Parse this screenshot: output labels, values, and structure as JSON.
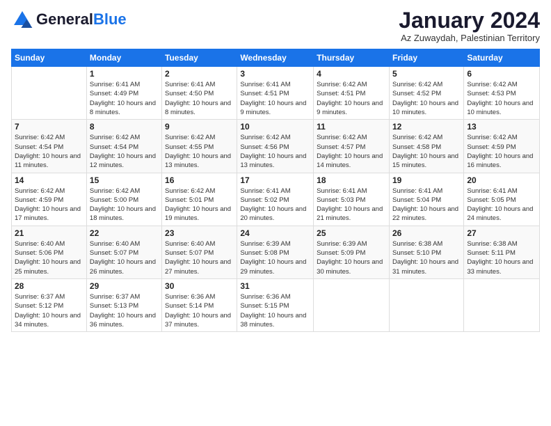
{
  "logo": {
    "general": "General",
    "blue": "Blue"
  },
  "header": {
    "month_year": "January 2024",
    "location": "Az Zuwaydah, Palestinian Territory"
  },
  "days_of_week": [
    "Sunday",
    "Monday",
    "Tuesday",
    "Wednesday",
    "Thursday",
    "Friday",
    "Saturday"
  ],
  "weeks": [
    [
      {
        "day": "",
        "sunrise": "",
        "sunset": "",
        "daylight": "",
        "empty": true
      },
      {
        "day": "1",
        "sunrise": "Sunrise: 6:41 AM",
        "sunset": "Sunset: 4:49 PM",
        "daylight": "Daylight: 10 hours and 8 minutes."
      },
      {
        "day": "2",
        "sunrise": "Sunrise: 6:41 AM",
        "sunset": "Sunset: 4:50 PM",
        "daylight": "Daylight: 10 hours and 8 minutes."
      },
      {
        "day": "3",
        "sunrise": "Sunrise: 6:41 AM",
        "sunset": "Sunset: 4:51 PM",
        "daylight": "Daylight: 10 hours and 9 minutes."
      },
      {
        "day": "4",
        "sunrise": "Sunrise: 6:42 AM",
        "sunset": "Sunset: 4:51 PM",
        "daylight": "Daylight: 10 hours and 9 minutes."
      },
      {
        "day": "5",
        "sunrise": "Sunrise: 6:42 AM",
        "sunset": "Sunset: 4:52 PM",
        "daylight": "Daylight: 10 hours and 10 minutes."
      },
      {
        "day": "6",
        "sunrise": "Sunrise: 6:42 AM",
        "sunset": "Sunset: 4:53 PM",
        "daylight": "Daylight: 10 hours and 10 minutes."
      }
    ],
    [
      {
        "day": "7",
        "sunrise": "Sunrise: 6:42 AM",
        "sunset": "Sunset: 4:54 PM",
        "daylight": "Daylight: 10 hours and 11 minutes."
      },
      {
        "day": "8",
        "sunrise": "Sunrise: 6:42 AM",
        "sunset": "Sunset: 4:54 PM",
        "daylight": "Daylight: 10 hours and 12 minutes."
      },
      {
        "day": "9",
        "sunrise": "Sunrise: 6:42 AM",
        "sunset": "Sunset: 4:55 PM",
        "daylight": "Daylight: 10 hours and 13 minutes."
      },
      {
        "day": "10",
        "sunrise": "Sunrise: 6:42 AM",
        "sunset": "Sunset: 4:56 PM",
        "daylight": "Daylight: 10 hours and 13 minutes."
      },
      {
        "day": "11",
        "sunrise": "Sunrise: 6:42 AM",
        "sunset": "Sunset: 4:57 PM",
        "daylight": "Daylight: 10 hours and 14 minutes."
      },
      {
        "day": "12",
        "sunrise": "Sunrise: 6:42 AM",
        "sunset": "Sunset: 4:58 PM",
        "daylight": "Daylight: 10 hours and 15 minutes."
      },
      {
        "day": "13",
        "sunrise": "Sunrise: 6:42 AM",
        "sunset": "Sunset: 4:59 PM",
        "daylight": "Daylight: 10 hours and 16 minutes."
      }
    ],
    [
      {
        "day": "14",
        "sunrise": "Sunrise: 6:42 AM",
        "sunset": "Sunset: 4:59 PM",
        "daylight": "Daylight: 10 hours and 17 minutes."
      },
      {
        "day": "15",
        "sunrise": "Sunrise: 6:42 AM",
        "sunset": "Sunset: 5:00 PM",
        "daylight": "Daylight: 10 hours and 18 minutes."
      },
      {
        "day": "16",
        "sunrise": "Sunrise: 6:42 AM",
        "sunset": "Sunset: 5:01 PM",
        "daylight": "Daylight: 10 hours and 19 minutes."
      },
      {
        "day": "17",
        "sunrise": "Sunrise: 6:41 AM",
        "sunset": "Sunset: 5:02 PM",
        "daylight": "Daylight: 10 hours and 20 minutes."
      },
      {
        "day": "18",
        "sunrise": "Sunrise: 6:41 AM",
        "sunset": "Sunset: 5:03 PM",
        "daylight": "Daylight: 10 hours and 21 minutes."
      },
      {
        "day": "19",
        "sunrise": "Sunrise: 6:41 AM",
        "sunset": "Sunset: 5:04 PM",
        "daylight": "Daylight: 10 hours and 22 minutes."
      },
      {
        "day": "20",
        "sunrise": "Sunrise: 6:41 AM",
        "sunset": "Sunset: 5:05 PM",
        "daylight": "Daylight: 10 hours and 24 minutes."
      }
    ],
    [
      {
        "day": "21",
        "sunrise": "Sunrise: 6:40 AM",
        "sunset": "Sunset: 5:06 PM",
        "daylight": "Daylight: 10 hours and 25 minutes."
      },
      {
        "day": "22",
        "sunrise": "Sunrise: 6:40 AM",
        "sunset": "Sunset: 5:07 PM",
        "daylight": "Daylight: 10 hours and 26 minutes."
      },
      {
        "day": "23",
        "sunrise": "Sunrise: 6:40 AM",
        "sunset": "Sunset: 5:07 PM",
        "daylight": "Daylight: 10 hours and 27 minutes."
      },
      {
        "day": "24",
        "sunrise": "Sunrise: 6:39 AM",
        "sunset": "Sunset: 5:08 PM",
        "daylight": "Daylight: 10 hours and 29 minutes."
      },
      {
        "day": "25",
        "sunrise": "Sunrise: 6:39 AM",
        "sunset": "Sunset: 5:09 PM",
        "daylight": "Daylight: 10 hours and 30 minutes."
      },
      {
        "day": "26",
        "sunrise": "Sunrise: 6:38 AM",
        "sunset": "Sunset: 5:10 PM",
        "daylight": "Daylight: 10 hours and 31 minutes."
      },
      {
        "day": "27",
        "sunrise": "Sunrise: 6:38 AM",
        "sunset": "Sunset: 5:11 PM",
        "daylight": "Daylight: 10 hours and 33 minutes."
      }
    ],
    [
      {
        "day": "28",
        "sunrise": "Sunrise: 6:37 AM",
        "sunset": "Sunset: 5:12 PM",
        "daylight": "Daylight: 10 hours and 34 minutes."
      },
      {
        "day": "29",
        "sunrise": "Sunrise: 6:37 AM",
        "sunset": "Sunset: 5:13 PM",
        "daylight": "Daylight: 10 hours and 36 minutes."
      },
      {
        "day": "30",
        "sunrise": "Sunrise: 6:36 AM",
        "sunset": "Sunset: 5:14 PM",
        "daylight": "Daylight: 10 hours and 37 minutes."
      },
      {
        "day": "31",
        "sunrise": "Sunrise: 6:36 AM",
        "sunset": "Sunset: 5:15 PM",
        "daylight": "Daylight: 10 hours and 38 minutes."
      },
      {
        "day": "",
        "sunrise": "",
        "sunset": "",
        "daylight": "",
        "empty": true
      },
      {
        "day": "",
        "sunrise": "",
        "sunset": "",
        "daylight": "",
        "empty": true
      },
      {
        "day": "",
        "sunrise": "",
        "sunset": "",
        "daylight": "",
        "empty": true
      }
    ]
  ]
}
